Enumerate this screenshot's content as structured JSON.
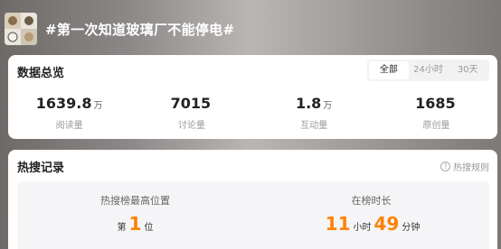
{
  "topic": {
    "title": "#第一次知道玻璃厂不能停电#"
  },
  "overview": {
    "title": "数据总览",
    "tabs": [
      {
        "label": "全部",
        "active": true
      },
      {
        "label": "24小时",
        "active": false
      },
      {
        "label": "30天",
        "active": false
      }
    ],
    "stats": [
      {
        "value": "1639.8",
        "unit": "万",
        "label": "阅读量"
      },
      {
        "value": "7015",
        "unit": "",
        "label": "讨论量"
      },
      {
        "value": "1.8",
        "unit": "万",
        "label": "互动量"
      },
      {
        "value": "1685",
        "unit": "",
        "label": "原创量"
      }
    ]
  },
  "hot": {
    "title": "热搜记录",
    "rules_label": "热搜规则",
    "rules_icon": "question-icon",
    "highest": {
      "label": "热搜榜最高位置",
      "prefix": "第",
      "value": "1",
      "suffix": "位"
    },
    "duration": {
      "label": "在榜时长",
      "hours": "11",
      "hours_unit": "小时",
      "minutes": "49",
      "minutes_unit": "分钟"
    },
    "accent_color": "#ff8200"
  }
}
